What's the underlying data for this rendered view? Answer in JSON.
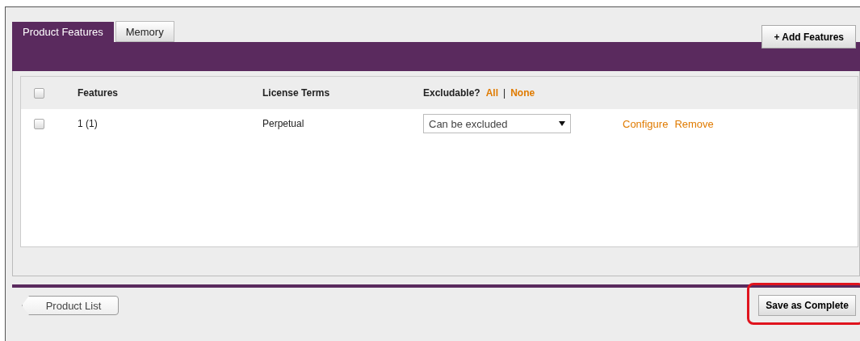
{
  "tabs": [
    {
      "label": "Product Features",
      "selected": true
    },
    {
      "label": "Memory",
      "selected": false
    }
  ],
  "add_button": "+ Add Features",
  "table": {
    "header_checked": false,
    "columns": [
      "Features",
      "License Terms"
    ],
    "excludable": {
      "label": "Excludable?",
      "all": "All",
      "separator": "|",
      "none": "None"
    },
    "rows": [
      {
        "checked": false,
        "feature": "1 (1)",
        "license": "Perpetual",
        "exclusion": "Can be excluded",
        "actions": [
          "Configure",
          "Remove"
        ]
      }
    ]
  },
  "footer": {
    "back_button": "Product List",
    "save_button": {
      "label": "Save as Complete",
      "highlighted": true
    }
  }
}
